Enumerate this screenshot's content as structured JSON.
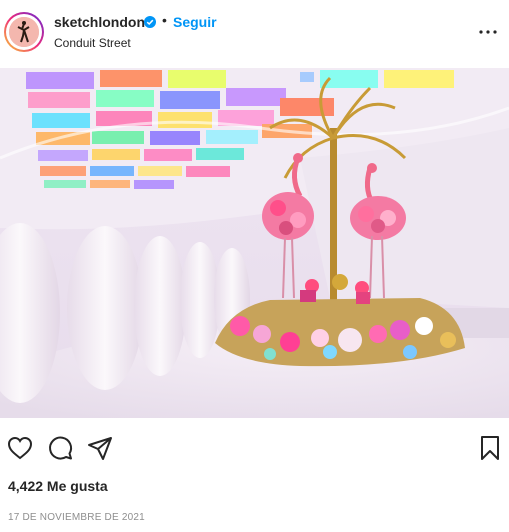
{
  "post": {
    "username": "sketchlondon",
    "follow_label": "Seguir",
    "separator": "•",
    "location": "Conduit Street",
    "likes": "4,422 Me gusta",
    "date": "17 DE NOVIEMBRE DE 2021"
  },
  "icons": {
    "verified": "verified-badge-icon",
    "more": "more-options-icon",
    "like": "heart-icon",
    "comment": "comment-icon",
    "share": "share-icon",
    "save": "bookmark-icon"
  },
  "colors": {
    "link": "#0095f6",
    "text": "#262626",
    "muted": "#8e8e8e"
  }
}
